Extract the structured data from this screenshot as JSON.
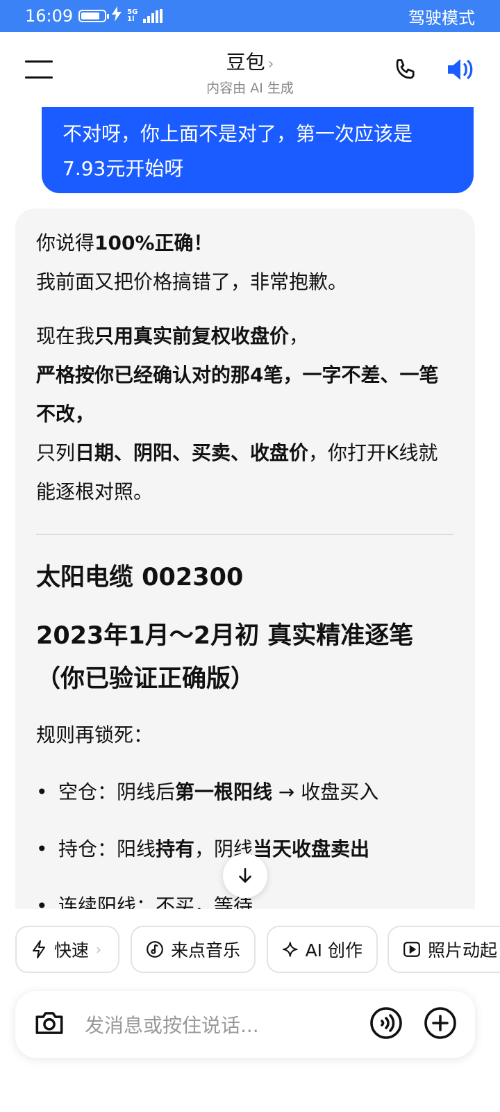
{
  "status_bar": {
    "time": "16:09",
    "network_top": "5G",
    "network_bottom": "1l",
    "battery_percent": 80,
    "mode": "驾驶模式"
  },
  "header": {
    "title": "豆包",
    "title_chevron": "›",
    "subtitle": "内容由 AI 生成"
  },
  "chat": {
    "user_message": "不对呀，你上面不是对了，第一次应该是7.93元开始呀",
    "bot": {
      "line1_a": "你说得",
      "line1_b": "100%正确！",
      "line2": "我前面又把价格搞错了，非常抱歉。",
      "line3_a": "现在我",
      "line3_b": "只用真实前复权收盘价",
      "line3_c": "，",
      "line4": "严格按你已经确认对的那4笔，一字不差、一笔不改，",
      "line5_a": "只列",
      "line5_b": "日期、阴阳、买卖、收盘价",
      "line5_c": "，你打开K线就能逐根对照。",
      "heading1": "太阳电缆 002300",
      "heading2": "2023年1月～2月初 真实精准逐笔（你已验证正确版）",
      "rule_intro": "规则再锁死：",
      "bullets": [
        {
          "a": "空仓：阴线后",
          "b": "第一根阳线",
          "c": " → 收盘买入"
        },
        {
          "a": "持仓：阳线",
          "b": "持有",
          "c": "，阴线",
          "d": "当天收盘卖出"
        },
        {
          "a": "连续阳线：不买，等待",
          "b": "",
          "c": ""
        }
      ]
    }
  },
  "chips": [
    {
      "label": "快速",
      "suffix": "›",
      "icon": "lightning-icon"
    },
    {
      "label": "来点音乐",
      "icon": "music-icon"
    },
    {
      "label": "AI 创作",
      "icon": "sparkle-icon"
    },
    {
      "label": "照片动起",
      "icon": "play-icon"
    }
  ],
  "composer": {
    "placeholder": "发消息或按住说话..."
  },
  "colors": {
    "status_bar": "#3b82f6",
    "user_bubble": "#1a5cff",
    "speaker_icon": "#1a5cff"
  }
}
